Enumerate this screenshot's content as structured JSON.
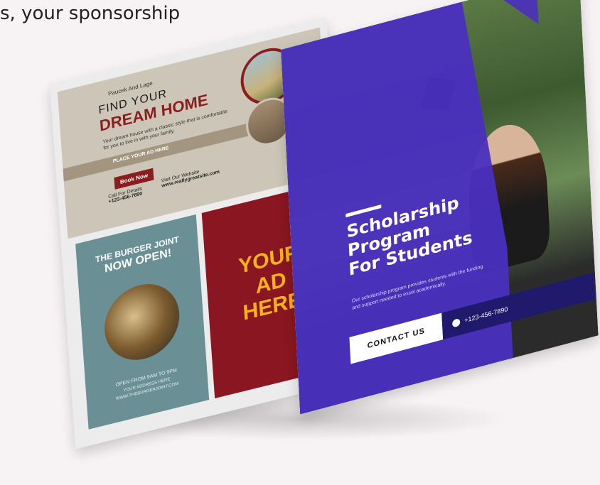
{
  "headline": "s, your sponsorship",
  "ad_home": {
    "brand": "Paucek And Lage",
    "find": "FIND YOUR",
    "dream": "DREAM HOME",
    "desc": "Your dream house with a classic style that is comfortable for you to live in with your family.",
    "band": "PLACE YOUR AD HERE",
    "book": "Book Now",
    "call_label": "Call For Details",
    "call_number": "+123-456-7890",
    "web_label": "Visit Our Website",
    "web_url": "www.reallygreatsite.com"
  },
  "ad_burger": {
    "line1": "THE BURGER JOINT",
    "line2": "NOW OPEN!",
    "hours": "OPEN FROM 9AM TO 9PM",
    "line_a": "YOUR ADDRESS HERE",
    "line_b": "WWW.THEBURGERJOINT.COM"
  },
  "ad_your": {
    "line1": "YOUR",
    "line2": "AD",
    "line3": "HERE"
  },
  "scholarship": {
    "title1": "Scholarship",
    "title2": "Program",
    "title3": "For Students",
    "desc": "Our scholarship program provides students with the funding and support needed to excel academically.",
    "contact": "CONTACT US",
    "phone": "+123-456-7890"
  }
}
